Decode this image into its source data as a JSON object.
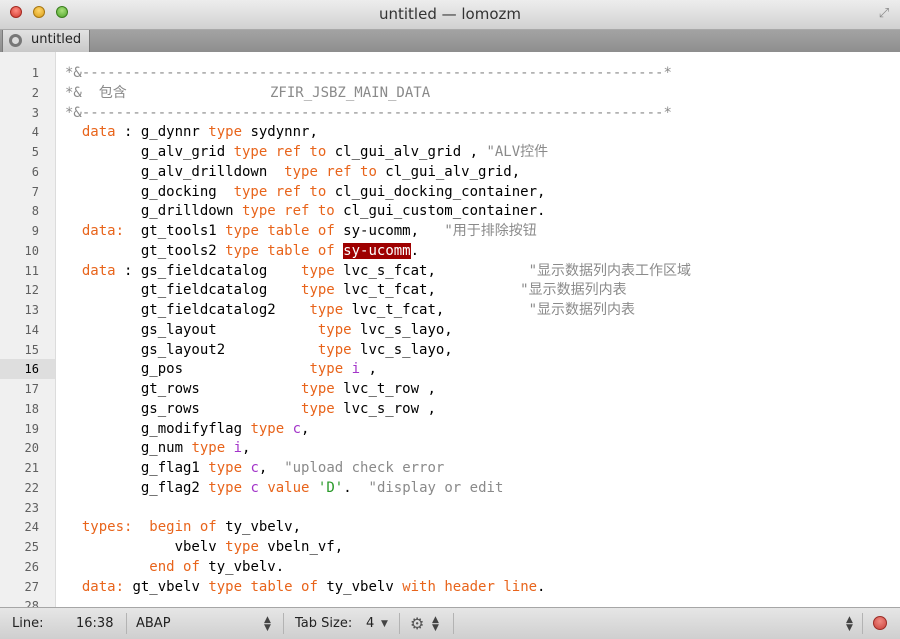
{
  "window": {
    "title": "untitled — lomozm"
  },
  "tabs": [
    {
      "label": "untitled"
    }
  ],
  "editor": {
    "current_line": 16,
    "lines": [
      {
        "n": "1",
        "tokens": [
          {
            "t": "*&---------------------------------------------------------------------*",
            "c": "cm"
          }
        ]
      },
      {
        "n": "2",
        "tokens": [
          {
            "t": "*&  包含                 ZFIR_JSBZ_MAIN_DATA",
            "c": "cm"
          }
        ]
      },
      {
        "n": "3",
        "tokens": [
          {
            "t": "*&---------------------------------------------------------------------*",
            "c": "cm"
          }
        ]
      },
      {
        "n": "4",
        "tokens": [
          {
            "t": "  "
          },
          {
            "t": "data",
            "c": "kw"
          },
          {
            "t": " : g_dynnr "
          },
          {
            "t": "type",
            "c": "kw"
          },
          {
            "t": " sydynnr,"
          }
        ]
      },
      {
        "n": "5",
        "tokens": [
          {
            "t": "         g_alv_grid "
          },
          {
            "t": "type ref to",
            "c": "kw"
          },
          {
            "t": " cl_gui_alv_grid , "
          },
          {
            "t": "\"ALV控件",
            "c": "cm"
          }
        ]
      },
      {
        "n": "6",
        "tokens": [
          {
            "t": "         g_alv_drilldown  "
          },
          {
            "t": "type ref to",
            "c": "kw"
          },
          {
            "t": " cl_gui_alv_grid,"
          }
        ]
      },
      {
        "n": "7",
        "tokens": [
          {
            "t": "         g_docking  "
          },
          {
            "t": "type ref to",
            "c": "kw"
          },
          {
            "t": " cl_gui_docking_container,"
          }
        ]
      },
      {
        "n": "8",
        "tokens": [
          {
            "t": "         g_drilldown "
          },
          {
            "t": "type ref to",
            "c": "kw"
          },
          {
            "t": " cl_gui_custom_container."
          }
        ]
      },
      {
        "n": "9",
        "tokens": [
          {
            "t": "  "
          },
          {
            "t": "data:",
            "c": "kw"
          },
          {
            "t": "  gt_tools1 "
          },
          {
            "t": "type table of",
            "c": "kw"
          },
          {
            "t": " sy-ucomm,   "
          },
          {
            "t": "\"用于排除按钮",
            "c": "cm"
          }
        ]
      },
      {
        "n": "10",
        "tokens": [
          {
            "t": "         gt_tools2 "
          },
          {
            "t": "type table of",
            "c": "kw"
          },
          {
            "t": " "
          },
          {
            "t": "sy-ucomm",
            "c": "hl"
          },
          {
            "t": "."
          }
        ]
      },
      {
        "n": "11",
        "tokens": [
          {
            "t": "  "
          },
          {
            "t": "data",
            "c": "kw"
          },
          {
            "t": " : gs_fieldcatalog    "
          },
          {
            "t": "type",
            "c": "kw"
          },
          {
            "t": " lvc_s_fcat,           "
          },
          {
            "t": "\"显示数据列内表工作区域",
            "c": "cm"
          }
        ]
      },
      {
        "n": "12",
        "tokens": [
          {
            "t": "         gt_fieldcatalog    "
          },
          {
            "t": "type",
            "c": "kw"
          },
          {
            "t": " lvc_t_fcat,          "
          },
          {
            "t": "\"显示数据列内表",
            "c": "cm"
          }
        ]
      },
      {
        "n": "13",
        "tokens": [
          {
            "t": "         gt_fieldcatalog2    "
          },
          {
            "t": "type",
            "c": "kw"
          },
          {
            "t": " lvc_t_fcat,          "
          },
          {
            "t": "\"显示数据列内表",
            "c": "cm"
          }
        ]
      },
      {
        "n": "14",
        "tokens": [
          {
            "t": "         gs_layout            "
          },
          {
            "t": "type",
            "c": "kw"
          },
          {
            "t": " lvc_s_layo,"
          }
        ]
      },
      {
        "n": "15",
        "tokens": [
          {
            "t": "         gs_layout2           "
          },
          {
            "t": "type",
            "c": "kw"
          },
          {
            "t": " lvc_s_layo,"
          }
        ]
      },
      {
        "n": "16",
        "tokens": [
          {
            "t": "         g_pos               "
          },
          {
            "t": "type",
            "c": "kw"
          },
          {
            "t": " "
          },
          {
            "t": "i",
            "c": "tp"
          },
          {
            "t": " ,"
          }
        ]
      },
      {
        "n": "17",
        "tokens": [
          {
            "t": "         gt_rows            "
          },
          {
            "t": "type",
            "c": "kw"
          },
          {
            "t": " lvc_t_row ,"
          }
        ]
      },
      {
        "n": "18",
        "tokens": [
          {
            "t": "         gs_rows            "
          },
          {
            "t": "type",
            "c": "kw"
          },
          {
            "t": " lvc_s_row ,"
          }
        ]
      },
      {
        "n": "19",
        "tokens": [
          {
            "t": "         g_modifyflag "
          },
          {
            "t": "type",
            "c": "kw"
          },
          {
            "t": " "
          },
          {
            "t": "c",
            "c": "tp"
          },
          {
            "t": ","
          }
        ]
      },
      {
        "n": "20",
        "tokens": [
          {
            "t": "         g_num "
          },
          {
            "t": "type",
            "c": "kw"
          },
          {
            "t": " "
          },
          {
            "t": "i",
            "c": "tp"
          },
          {
            "t": ","
          }
        ]
      },
      {
        "n": "21",
        "tokens": [
          {
            "t": "         g_flag1 "
          },
          {
            "t": "type",
            "c": "kw"
          },
          {
            "t": " "
          },
          {
            "t": "c",
            "c": "tp"
          },
          {
            "t": ",  "
          },
          {
            "t": "\"upload check error",
            "c": "cm"
          }
        ]
      },
      {
        "n": "22",
        "tokens": [
          {
            "t": "         g_flag2 "
          },
          {
            "t": "type",
            "c": "kw"
          },
          {
            "t": " "
          },
          {
            "t": "c",
            "c": "tp"
          },
          {
            "t": " "
          },
          {
            "t": "value",
            "c": "kw"
          },
          {
            "t": " "
          },
          {
            "t": "'D'",
            "c": "st"
          },
          {
            "t": ".  "
          },
          {
            "t": "\"display or edit",
            "c": "cm"
          }
        ]
      },
      {
        "n": "23",
        "tokens": []
      },
      {
        "n": "24",
        "tokens": [
          {
            "t": "  "
          },
          {
            "t": "types:",
            "c": "kw"
          },
          {
            "t": "  "
          },
          {
            "t": "begin of",
            "c": "kw"
          },
          {
            "t": " ty_vbelv,"
          }
        ]
      },
      {
        "n": "25",
        "tokens": [
          {
            "t": "             vbelv "
          },
          {
            "t": "type",
            "c": "kw"
          },
          {
            "t": " vbeln_vf,"
          }
        ]
      },
      {
        "n": "26",
        "tokens": [
          {
            "t": "          "
          },
          {
            "t": "end of",
            "c": "kw"
          },
          {
            "t": " ty_vbelv."
          }
        ]
      },
      {
        "n": "27",
        "tokens": [
          {
            "t": "  "
          },
          {
            "t": "data:",
            "c": "kw"
          },
          {
            "t": " gt_vbelv "
          },
          {
            "t": "type table of",
            "c": "kw"
          },
          {
            "t": " ty_vbelv "
          },
          {
            "t": "with header line",
            "c": "kw"
          },
          {
            "t": "."
          }
        ]
      },
      {
        "n": "28",
        "tokens": []
      }
    ]
  },
  "status": {
    "line_label": "Line:",
    "position": "16:38",
    "language": "ABAP",
    "tab_size_label": "Tab Size:",
    "tab_size": "4"
  },
  "icons": {
    "tab_close": "tab-close-icon",
    "settings": "gear-icon",
    "record": "record-icon",
    "fullscreen": "fullscreen-icon"
  }
}
